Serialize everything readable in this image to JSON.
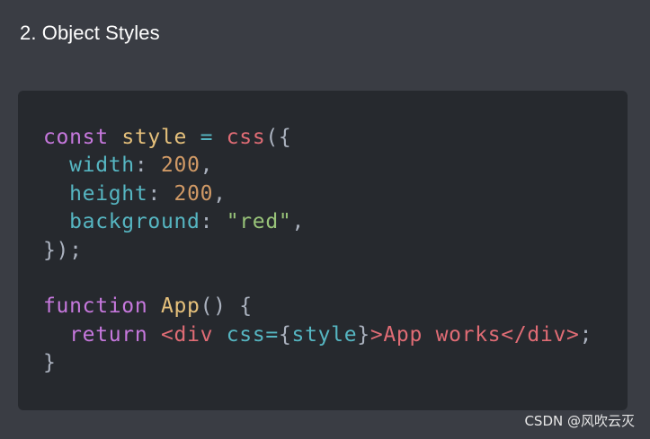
{
  "heading": "2. Object Styles",
  "watermark": "CSDN @风吹云灭",
  "code": {
    "language": "javascript",
    "lines": [
      [
        {
          "text": "const",
          "kind": "keyword"
        },
        {
          "text": " ",
          "kind": "punct"
        },
        {
          "text": "style",
          "kind": "ident"
        },
        {
          "text": " = ",
          "kind": "op"
        },
        {
          "text": "css",
          "kind": "call"
        },
        {
          "text": "({",
          "kind": "punct"
        }
      ],
      [
        {
          "text": "  ",
          "kind": "punct"
        },
        {
          "text": "width",
          "kind": "prop"
        },
        {
          "text": ": ",
          "kind": "punct"
        },
        {
          "text": "200",
          "kind": "num"
        },
        {
          "text": ",",
          "kind": "punct"
        }
      ],
      [
        {
          "text": "  ",
          "kind": "punct"
        },
        {
          "text": "height",
          "kind": "prop"
        },
        {
          "text": ": ",
          "kind": "punct"
        },
        {
          "text": "200",
          "kind": "num"
        },
        {
          "text": ",",
          "kind": "punct"
        }
      ],
      [
        {
          "text": "  ",
          "kind": "punct"
        },
        {
          "text": "background",
          "kind": "prop"
        },
        {
          "text": ": ",
          "kind": "punct"
        },
        {
          "text": "\"red\"",
          "kind": "str"
        },
        {
          "text": ",",
          "kind": "punct"
        }
      ],
      [
        {
          "text": "});",
          "kind": "punct"
        }
      ],
      [],
      [
        {
          "text": "function",
          "kind": "keyword"
        },
        {
          "text": " ",
          "kind": "punct"
        },
        {
          "text": "App",
          "kind": "func"
        },
        {
          "text": "() {",
          "kind": "punct"
        }
      ],
      [
        {
          "text": "  ",
          "kind": "punct"
        },
        {
          "text": "return",
          "kind": "keyword"
        },
        {
          "text": " ",
          "kind": "punct"
        },
        {
          "text": "<div",
          "kind": "tag"
        },
        {
          "text": " ",
          "kind": "punct"
        },
        {
          "text": "css",
          "kind": "attr"
        },
        {
          "text": "=",
          "kind": "op"
        },
        {
          "text": "{",
          "kind": "punct"
        },
        {
          "text": "style",
          "kind": "attr"
        },
        {
          "text": "}",
          "kind": "punct"
        },
        {
          "text": ">App works</div>",
          "kind": "text"
        },
        {
          "text": ";",
          "kind": "punct"
        }
      ],
      [
        {
          "text": "}",
          "kind": "punct"
        }
      ]
    ]
  },
  "colors": {
    "page_background": "#3a3d44",
    "code_background": "#26292e",
    "keyword": "#c678dd",
    "identifier": "#e5c07b",
    "property": "#56b6c2",
    "number": "#d19a66",
    "string": "#98c379",
    "tag": "#e06c75"
  }
}
